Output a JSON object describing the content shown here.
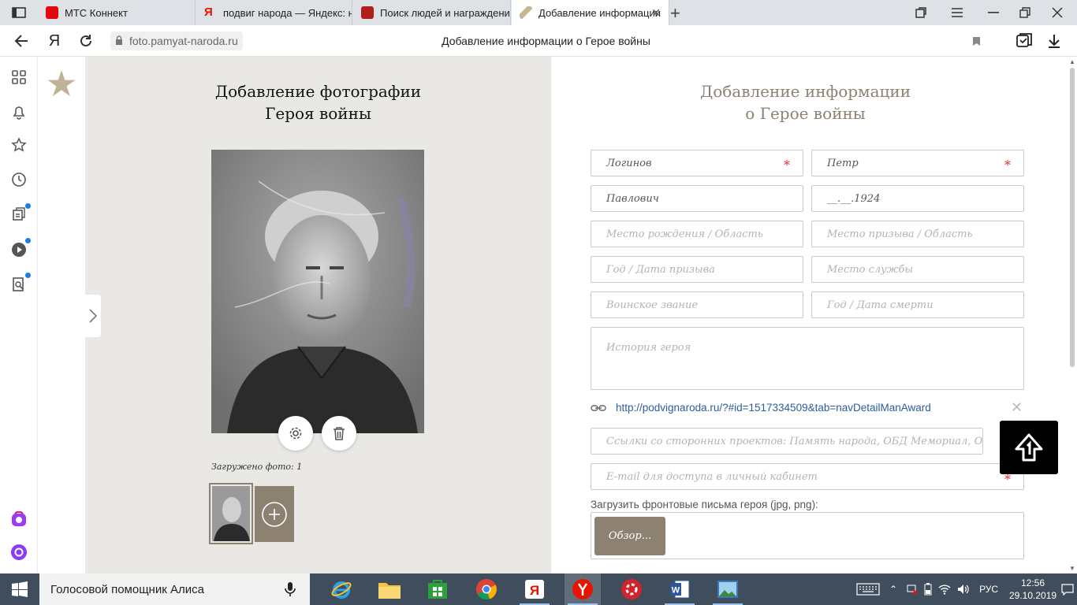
{
  "browser": {
    "tabs": [
      {
        "label": "МТС Коннект",
        "fav_color": "#e30611"
      },
      {
        "label": "подвиг народа — Яндекс: нашлось",
        "fav_color": "#ffffff"
      },
      {
        "label": "Поиск людей и награждений",
        "fav_color": "#b01d1d"
      },
      {
        "label": "Добавление информации",
        "fav_color": "#c8b78e"
      }
    ],
    "url": "foto.pamyat-naroda.ru",
    "page_title": "Добавление информации о Герое войны",
    "yandex_logo": "Я"
  },
  "photo_section": {
    "title_line1": "Добавление фотографии",
    "title_line2": "Героя войны",
    "uploaded_text": "Загружено фото: 1"
  },
  "form": {
    "title_line1": "Добавление информации",
    "title_line2": "о Герое войны",
    "fields": {
      "last_name": "Логинов",
      "first_name": "Петр",
      "patronymic": "Павлович",
      "birth_date": "__.__.1924",
      "birth_place": "Место рождения / Область",
      "draft_place": "Место призыва / Область",
      "draft_date": "Год / Дата призыва",
      "service_place": "Место службы",
      "rank": "Воинское звание",
      "death_date": "Год / Дата смерти",
      "story": "История героя",
      "external_links": "Ссылки со сторонних проектов: Память народа, ОБД Мемориал, ОБД",
      "email": "E-mail для доступа в личный кабинет"
    },
    "required_mark": "*",
    "link": "http://podvignaroda.ru/?#id=1517334509&tab=navDetailManAward",
    "link_close": "✕",
    "letters_label": "Загрузить фронтовые письма героя (jpg, png):",
    "browse_label": "Обзор..."
  },
  "taskbar": {
    "search_text": "Голосовой помощник Алиса",
    "lang": "РУС",
    "time": "12:56",
    "date": "29.10.2019"
  },
  "colors": {
    "accent": "#8d8271",
    "link": "#2a5d9c",
    "required": "#dd3333",
    "panel_bg": "#eae8e4",
    "taskbar_bg": "#3f4d5c"
  },
  "icons": [
    "sidebar-toggle-icon",
    "back-icon",
    "yandex-icon",
    "reload-icon",
    "lock-icon",
    "bookmark-icon",
    "collections-icon",
    "download-icon",
    "grid-icon",
    "bell-icon",
    "star-icon",
    "clock-icon",
    "notes-icon",
    "play-icon",
    "search-doc-icon",
    "alice-app-icon",
    "alice-icon",
    "gear-icon",
    "trash-icon",
    "plus-circle-icon",
    "chain-icon",
    "upload-arrow-icon",
    "windows-icon",
    "mic-icon"
  ]
}
